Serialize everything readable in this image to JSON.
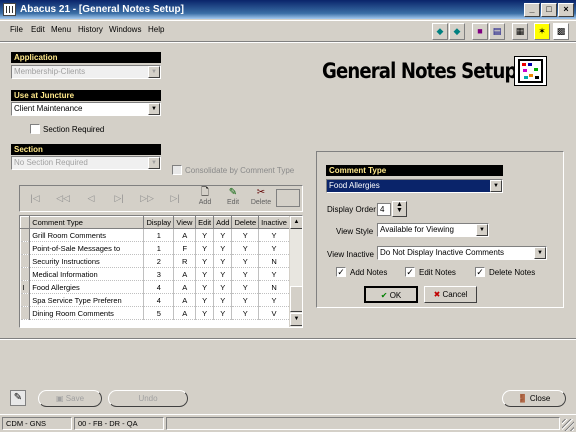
{
  "window": {
    "title": "Abacus 21 - [General Notes Setup]"
  },
  "menu": [
    "File",
    "Edit",
    "Menu",
    "History",
    "Windows",
    "Help"
  ],
  "toolbar_icons": [
    "arrow-left-icon",
    "arrow-right-icon",
    "book-icon",
    "book2-icon",
    "help-icon",
    "calculator-icon",
    "run-icon",
    "abacus-icon"
  ],
  "page": {
    "heading": "General Notes Setup"
  },
  "application": {
    "label": "Application",
    "value": "Membership-Clients"
  },
  "juncture": {
    "label": "Use at Juncture",
    "value": "Client Maintenance",
    "section_required": "Section Required"
  },
  "section": {
    "label": "Section",
    "value": "No Section Required",
    "consolidate": "Consolidate by Comment Type"
  },
  "nav": {
    "add": "Add",
    "edit": "Edit",
    "delete": "Delete"
  },
  "grid": {
    "columns": [
      "Comment Type",
      "Display",
      "View",
      "Edit",
      "Add",
      "Delete",
      "Inactive"
    ],
    "rows": [
      [
        "Grill Room Comments",
        "1",
        "A",
        "Y",
        "Y",
        "Y",
        "Y"
      ],
      [
        "Point-of-Sale Messages to",
        "1",
        "F",
        "Y",
        "Y",
        "Y",
        "Y"
      ],
      [
        "Security Instructions",
        "2",
        "R",
        "Y",
        "Y",
        "Y",
        "N"
      ],
      [
        "Medical Information",
        "3",
        "A",
        "Y",
        "Y",
        "Y",
        "Y"
      ],
      [
        "Food Allergies",
        "4",
        "A",
        "Y",
        "Y",
        "Y",
        "N"
      ],
      [
        "Spa Service Type Preferen",
        "4",
        "A",
        "Y",
        "Y",
        "Y",
        "Y"
      ],
      [
        "Dining Room Comments",
        "5",
        "A",
        "Y",
        "Y",
        "Y",
        "V"
      ]
    ]
  },
  "detail": {
    "comment_type_label": "Comment Type",
    "comment_type_value": "Food Allergies",
    "display_order_label": "Display Order",
    "display_order_value": "4",
    "view_style_label": "View Style",
    "view_style_value": "Available for Viewing",
    "view_inactive_label": "View Inactive",
    "view_inactive_value": "Do Not Display Inactive Comments",
    "add_notes": "Add Notes",
    "edit_notes": "Edit Notes",
    "delete_notes": "Delete Notes",
    "ok": "OK",
    "cancel": "Cancel"
  },
  "bottom": {
    "save": "Save",
    "undo": "Undo",
    "close": "Close"
  },
  "status": [
    "CDM - GNS",
    "00 - FB - DR - QA"
  ]
}
